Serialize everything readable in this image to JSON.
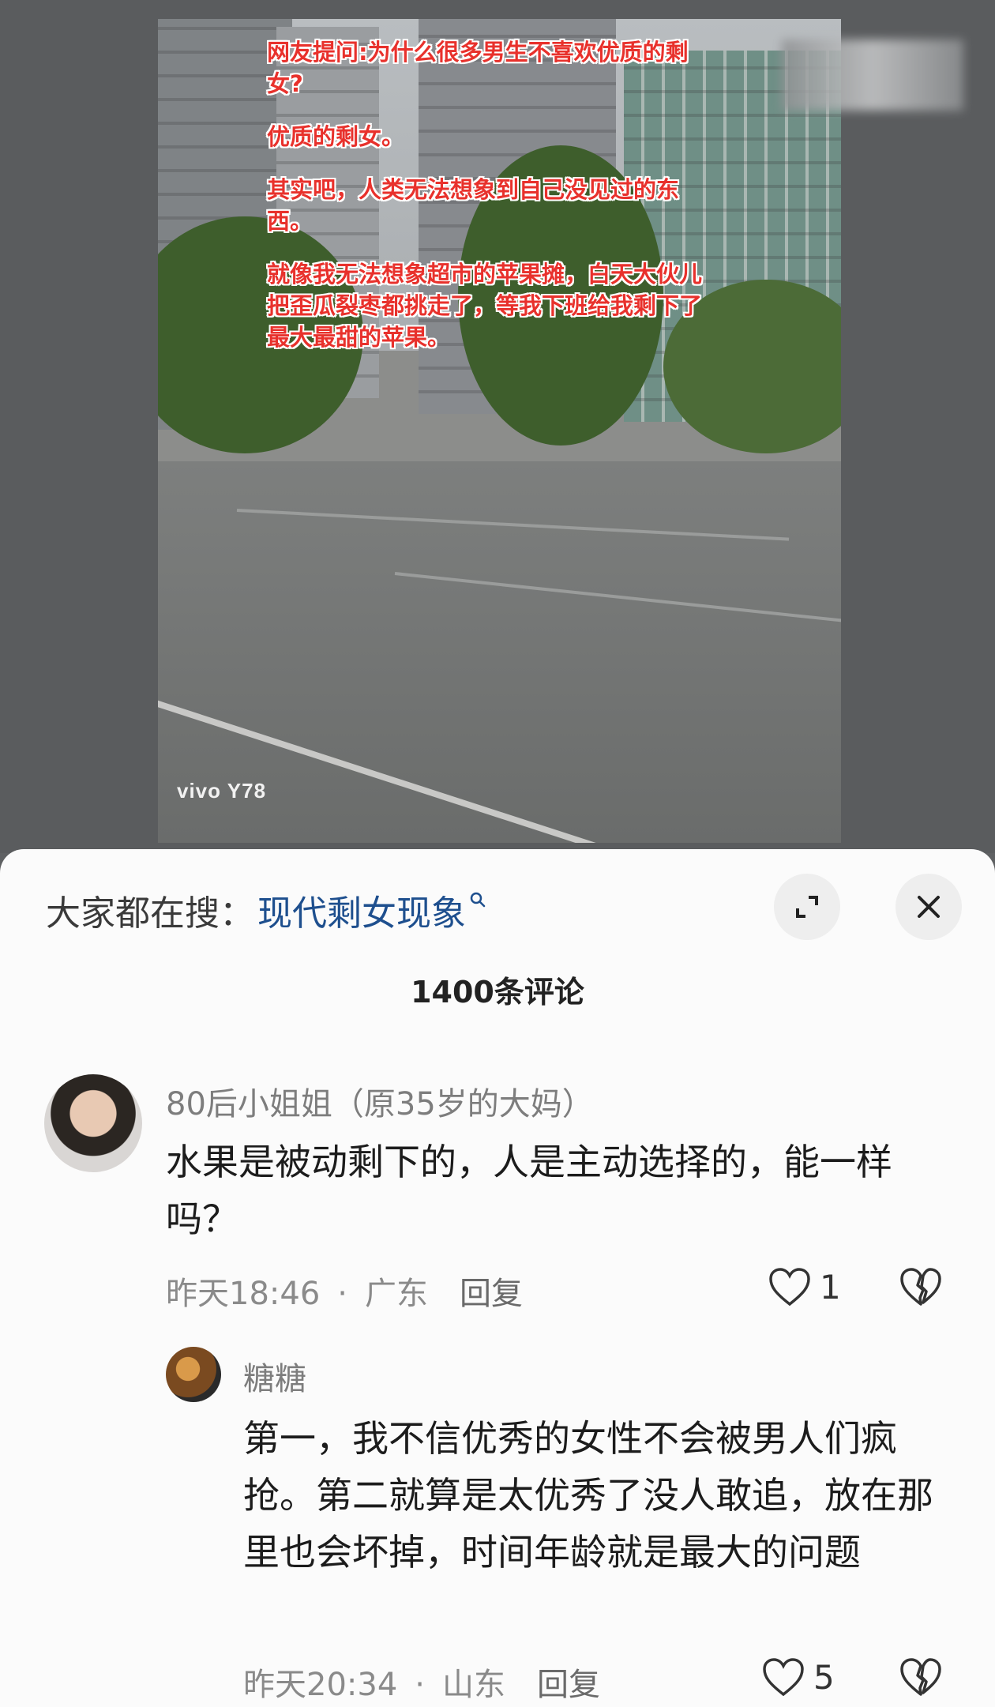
{
  "video": {
    "overlay_lines": [
      "网友提问:为什么很多男生不喜欢优质的剩女?",
      "优质的剩女。",
      "其实吧，人类无法想象到自己没见过的东西。",
      "就像我无法想象超市的苹果摊，白天大伙儿把歪瓜裂枣都挑走了，等我下班给我剩下了最大最甜的苹果。"
    ],
    "watermark": "vivo Y78"
  },
  "sheet": {
    "search_prefix": "大家都在搜：",
    "search_term": "现代剩女现象",
    "search_icon": "search-icon",
    "expand_icon": "expand-icon",
    "close_icon": "close-icon",
    "comment_count": "1400条评论"
  },
  "comments": [
    {
      "author": "80后小姐姐（原35岁的大妈）",
      "text": "水果是被动剩下的，人是主动选择的，能一样吗？",
      "time": "昨天18:46",
      "location": "广东",
      "reply": "回复",
      "likes": "1"
    },
    {
      "author": "糖糖",
      "text": "第一，我不信优秀的女性不会被男人们疯抢。第二就算是太优秀了没人敢追，放在那里也会坏掉，时间年龄就是最大的问题",
      "time": "昨天20:34",
      "location": "山东",
      "reply": "回复",
      "likes": "5"
    }
  ],
  "colors": {
    "overlay_text": "#e8312c",
    "search_term": "#1e4f8e"
  }
}
